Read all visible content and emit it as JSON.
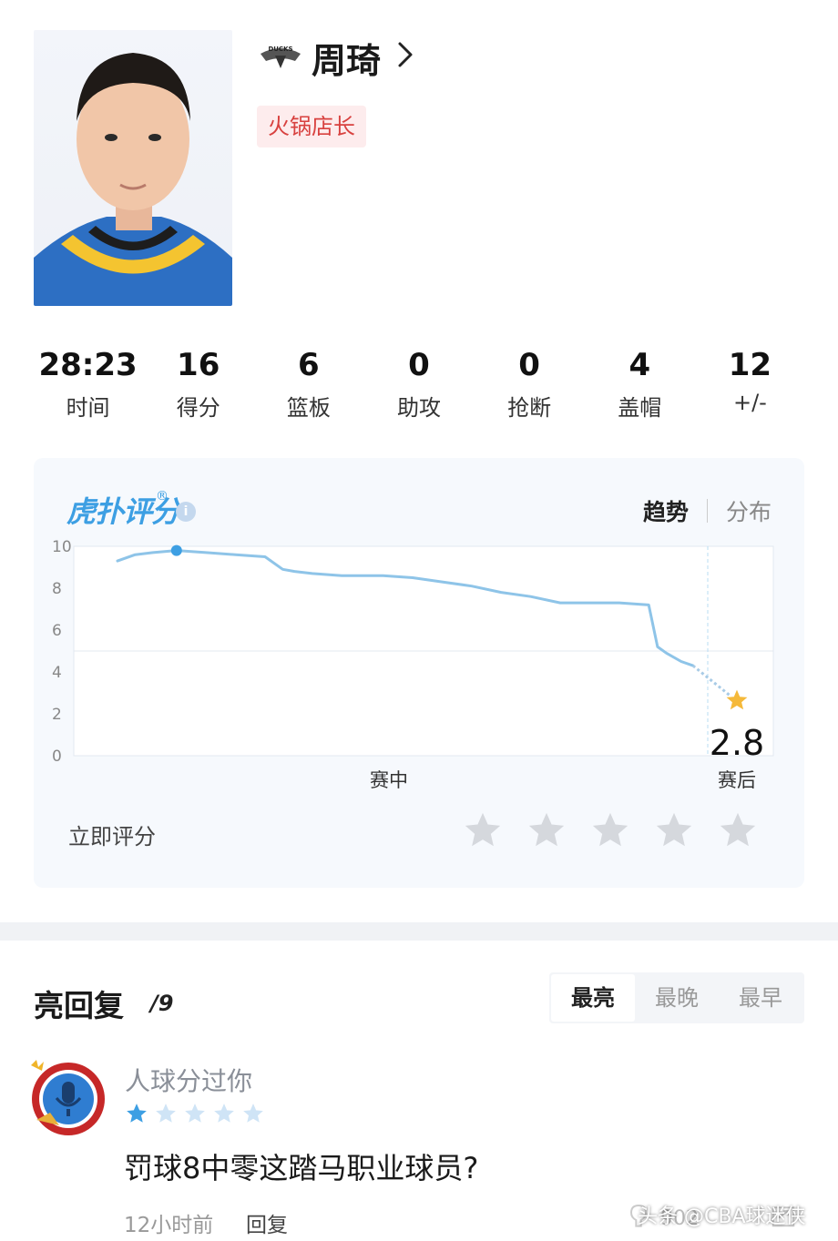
{
  "player": {
    "name": "周琦",
    "tag": "火锅店长",
    "team_logo_text": "DUCKS"
  },
  "stats": [
    {
      "value": "28:23",
      "label": "时间"
    },
    {
      "value": "16",
      "label": "得分"
    },
    {
      "value": "6",
      "label": "篮板"
    },
    {
      "value": "0",
      "label": "助攻"
    },
    {
      "value": "0",
      "label": "抢断"
    },
    {
      "value": "4",
      "label": "盖帽"
    },
    {
      "value": "12",
      "label": "+/-"
    }
  ],
  "rating": {
    "brand": "虎扑评分",
    "brand_mark": "®",
    "info_icon": "i",
    "tabs": {
      "active": "趋势",
      "inactive": "分布"
    },
    "rate_now_label": "立即评分",
    "user_rating_stars": 0,
    "colors": {
      "line": "#8ec4e8",
      "accent": "#3d9fe3",
      "star": "#f5b93a"
    }
  },
  "chart_data": {
    "type": "line",
    "ylim": [
      0,
      10
    ],
    "y_ticks": [
      "10",
      "8",
      "6",
      "4",
      "2",
      "0"
    ],
    "x_labels": [
      "赛中",
      "赛后"
    ],
    "series": [
      {
        "x": [
          0.0,
          0.03,
          0.06,
          0.1,
          0.15,
          0.2,
          0.25,
          0.28,
          0.3,
          0.33,
          0.38,
          0.45,
          0.5,
          0.55,
          0.6,
          0.65,
          0.7,
          0.75,
          0.8,
          0.85,
          0.9,
          0.915,
          0.93,
          0.955,
          0.975
        ],
        "values": [
          9.3,
          9.6,
          9.7,
          9.8,
          9.7,
          9.6,
          9.5,
          8.9,
          8.8,
          8.7,
          8.6,
          8.6,
          8.5,
          8.3,
          8.1,
          7.8,
          7.6,
          7.3,
          7.3,
          7.3,
          7.2,
          5.2,
          4.9,
          4.5,
          4.3
        ]
      }
    ],
    "highlight_point": {
      "x": 0.1,
      "value": 9.8
    },
    "final_score": "2.8",
    "final_value": 2.8
  },
  "replies": {
    "title": "亮回复",
    "count": "/9",
    "sort_tabs": [
      "最亮",
      "最晚",
      "最早"
    ],
    "active_sort": 0,
    "items": [
      {
        "username": "人球分过你",
        "stars": 1,
        "text": "罚球8中零这踏马职业球员?",
        "time": "12小时前",
        "reply_label": "回复",
        "like_count": "902"
      }
    ]
  },
  "watermark": "头条 @CBA球迷侠"
}
